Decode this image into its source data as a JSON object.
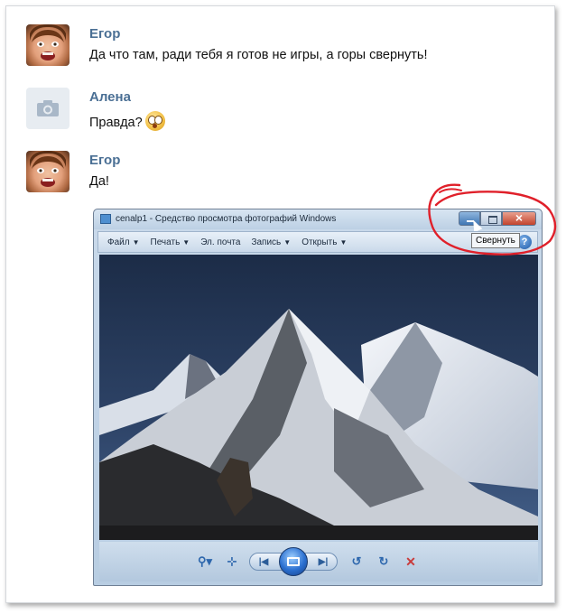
{
  "messages": [
    {
      "author": "Егор",
      "text": "Да что там, ради тебя я готов не игры, а горы свернуть!",
      "avatar": "photo-avatar"
    },
    {
      "author": "Алена",
      "text": "Правда?",
      "avatar": "camera-icon",
      "emoji": "flushed-emoji-icon"
    },
    {
      "author": "Егор",
      "text": "Да!",
      "avatar": "photo-avatar"
    }
  ],
  "viewer": {
    "title": "cenalp1 - Средство просмотра фотографий Windows",
    "menu": [
      {
        "label": "Файл",
        "arrow": "▼"
      },
      {
        "label": "Печать",
        "arrow": "▼"
      },
      {
        "label": "Эл. почта",
        "arrow": ""
      },
      {
        "label": "Запись",
        "arrow": "▼"
      },
      {
        "label": "Открыть",
        "arrow": "▼"
      }
    ],
    "help": "?",
    "tooltip": "Свернуть",
    "controls": {
      "zoom": "⚲▾",
      "fit": "⊹",
      "prev": "|◀",
      "next": "▶|",
      "rotate_ccw": "↺",
      "rotate_cw": "↻",
      "delete": "✕"
    }
  },
  "colors": {
    "author": "#4a6f94",
    "annotation_circle": "#e0202a",
    "window_chrome": "#c9d9ea"
  }
}
